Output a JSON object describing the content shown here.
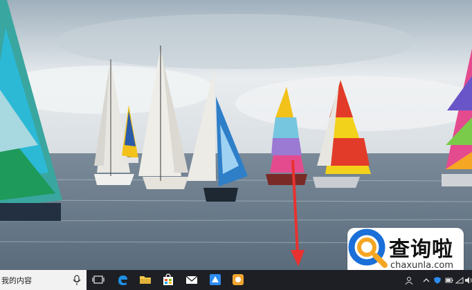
{
  "taskbar": {
    "search_text": "我的内容",
    "pinned_apps": [
      "task-view-icon",
      "edge-icon",
      "file-explorer-icon",
      "store-icon",
      "mail-icon",
      "app-icon-blue",
      "app-icon-orange"
    ],
    "tray_icons": [
      "people-icon",
      "chevron-up-icon",
      "defender-icon",
      "battery-icon",
      "network-icon",
      "volume-icon"
    ]
  },
  "watermark": {
    "title": "查询啦",
    "url": "chaxunla.com"
  },
  "colors": {
    "taskbar": "#1d1f24",
    "annotation_arrow": "#e8322f",
    "watermark_blue": "#1a6fd8",
    "watermark_orange": "#f5a623"
  }
}
